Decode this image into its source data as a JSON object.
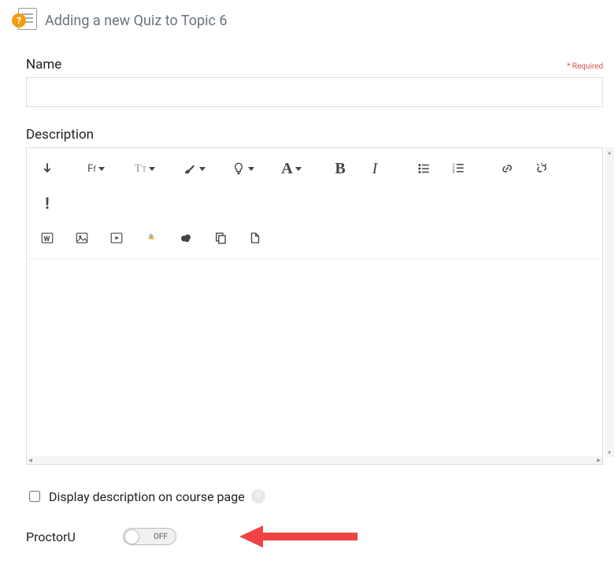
{
  "header": {
    "title": "Adding a new Quiz to Topic 6",
    "icon_badge": "?"
  },
  "fields": {
    "name": {
      "label": "Name",
      "value": "",
      "required_text": "* Required"
    },
    "description": {
      "label": "Description",
      "value": ""
    },
    "display_description": {
      "label": "Display description on course page",
      "checked": false,
      "help": "?"
    },
    "proctoru": {
      "label": "ProctorU",
      "state_text": "OFF",
      "state": false
    }
  },
  "editor_toolbar": {
    "row1": [
      "toggle-toolbar",
      "font-family",
      "heading",
      "brush",
      "lightbulb",
      "font-color",
      "bold",
      "italic",
      "bullet-list",
      "numbered-list",
      "link",
      "unlink",
      "exclaim"
    ],
    "row2": [
      "word",
      "image",
      "video",
      "sparkle",
      "cloud",
      "copy",
      "paste"
    ]
  }
}
